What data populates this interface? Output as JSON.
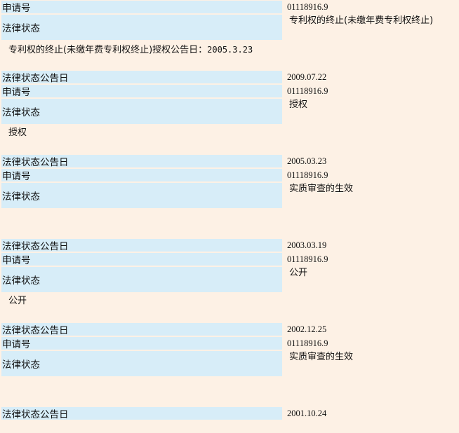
{
  "labels": {
    "app_no": "申请号",
    "status": "法律状态",
    "pub_date": "法律状态公告日"
  },
  "records": [
    {
      "app_no": "01118916.9",
      "status": "专利权的终止(未缴年费专利权终止)",
      "note_text": "专利权的终止(未缴年费专利权终止)授权公告日：",
      "note_date": "2005.3.23"
    },
    {
      "pub_date": "2009.07.22",
      "app_no": "01118916.9",
      "status": "授权",
      "note_text": "授权"
    },
    {
      "pub_date": "2005.03.23",
      "app_no": "01118916.9",
      "status": "实质审查的生效"
    },
    {
      "pub_date": "2003.03.19",
      "app_no": "01118916.9",
      "status": "公开",
      "note_text": "公开"
    },
    {
      "pub_date": "2002.12.25",
      "app_no": "01118916.9",
      "status": "实质审查的生效"
    },
    {
      "pub_date": "2001.10.24"
    }
  ]
}
